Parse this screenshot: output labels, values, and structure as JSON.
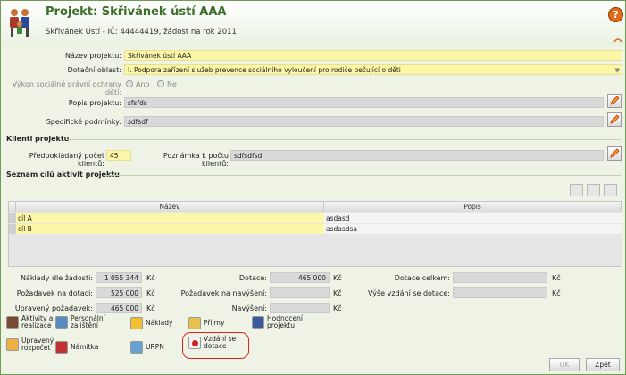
{
  "header": {
    "title": "Projekt: Skřivánek ústí AAA",
    "subtitle": "Skřivánek Ústí - IČ: 44444419, žádost na rok 2011",
    "help_label": "?"
  },
  "form": {
    "nazev_label": "Název projektu:",
    "nazev_value": "Skřivánek ústí AAA",
    "oblast_label": "Dotační oblast:",
    "oblast_value": "I. Podpora zařízení služeb prevence sociálního vyloučení pro rodiče pečující o děti",
    "vykon_label": "Výkon sociálně právní ochrany dětí:",
    "ano_label": "Ano",
    "ne_label": "Ne",
    "popis_label": "Popis projektu:",
    "popis_value": "sfsfds",
    "spec_label": "Specifické podmínky:",
    "spec_value": "sdfsdf"
  },
  "klienti": {
    "section_label": "Klienti projektu",
    "pocet_label": "Předpokládaný počet klientů:",
    "pocet_value": "45",
    "poznamka_label": "Poznámka k počtu klientů:",
    "poznamka_value": "sdfsdfsd"
  },
  "cile": {
    "section_label": "Seznam cílů aktivit projektu",
    "columns": [
      "Název",
      "Popis"
    ],
    "rows": [
      {
        "nazev": "cíl A",
        "popis": "asdasd"
      },
      {
        "nazev": "cíl B",
        "popis": "asdasdsa"
      }
    ]
  },
  "finance": {
    "naklady_label": "Náklady dle žádosti:",
    "naklady_value": "1 055 344",
    "pozadavek_label": "Požadavek na dotaci:",
    "pozadavek_value": "525 000",
    "upraveny_label": "Upravený požadavek:",
    "upraveny_value": "465 000",
    "dotace_label": "Dotace:",
    "dotace_value": "465 000",
    "navyseni_pozadavek_label": "Požadavek na navýšení:",
    "navyseni_pozadavek_value": "",
    "navyseni_label": "Navýšení:",
    "navyseni_value": "",
    "dotace_celkem_label": "Dotace celkem:",
    "dotace_celkem_value": "",
    "vyse_vzdani_label": "Výše vzdání se dotace:",
    "vyse_vzdani_value": "",
    "currency": "Kč"
  },
  "nav_buttons": {
    "aktivity": "Aktivity a realizace",
    "personalni": "Personální zajištění",
    "naklady": "Náklady",
    "prijmy": "Příjmy",
    "hodnoceni": "Hodnocení projektu",
    "upraveny_rozpocet": "Upravený rozpočet",
    "namitka": "Námitka",
    "urpn": "URPN",
    "vzdani": "Vzdání se dotace"
  },
  "footer": {
    "ok_label": "OK",
    "zpet_label": "Zpět"
  },
  "colors": {
    "accent_green": "#3c6e2a",
    "field_yellow": "#fbf7a7",
    "highlight_red": "#e02020"
  }
}
